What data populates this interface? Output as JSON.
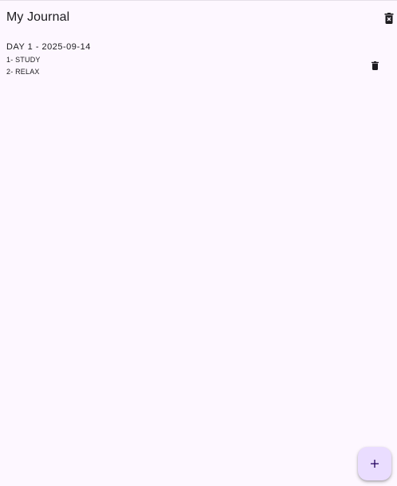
{
  "app_bar": {
    "title": "My Journal",
    "delete_all_icon": "delete-forever-icon"
  },
  "entries": [
    {
      "title": "DAY 1 - 2025-09-14",
      "lines": [
        "1- STUDY",
        "2- RELAX"
      ],
      "delete_icon": "delete-icon"
    }
  ],
  "fab": {
    "icon": "plus-icon"
  },
  "colors": {
    "background": "#FDF7FF",
    "fab_background": "#EADDFF",
    "icon": "#1C1B1F",
    "fab_icon": "#21005D"
  }
}
